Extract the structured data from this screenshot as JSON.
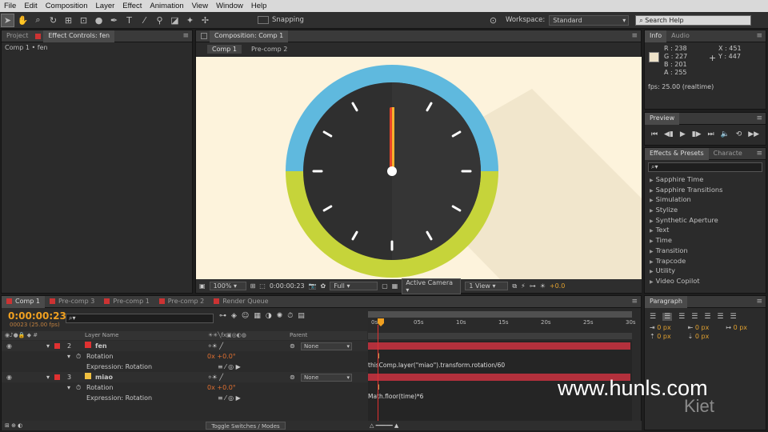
{
  "menu": [
    "File",
    "Edit",
    "Composition",
    "Layer",
    "Effect",
    "Animation",
    "View",
    "Window",
    "Help"
  ],
  "toolbar": {
    "snapping": "Snapping",
    "workspace_label": "Workspace:",
    "workspace_value": "Standard",
    "search_help": "Search Help"
  },
  "project_panel": {
    "tab_project": "Project",
    "tab_effect_controls": "Effect Controls: fen",
    "subtitle": "Comp 1 • fen"
  },
  "comp_panel": {
    "tab": "Composition: Comp 1",
    "breadcrumbs": [
      "Comp 1",
      "Pre-comp 2"
    ],
    "zoom": "100%",
    "timecode": "0:00:00:23",
    "resolution": "Full",
    "camera": "Active Camera",
    "view": "1 View",
    "exposure": "+0.0"
  },
  "info": {
    "tab_info": "Info",
    "tab_audio": "Audio",
    "r": "R : 238",
    "g": "G : 227",
    "b": "B : 201",
    "a": "A : 255",
    "x": "X : 451",
    "y": "Y : 447",
    "fps": "fps: 25.00 (realtime)"
  },
  "preview": {
    "tab": "Preview"
  },
  "effects": {
    "tab": "Effects & Presets",
    "tab2": "Characte",
    "items": [
      "Sapphire Time",
      "Sapphire Transitions",
      "Simulation",
      "Stylize",
      "Synthetic Aperture",
      "Text",
      "Time",
      "Transition",
      "Trapcode",
      "Utility",
      "Video Copilot"
    ]
  },
  "paragraph": {
    "tab": "Paragraph",
    "px_values": [
      "0 px",
      "0 px",
      "0 px",
      "0 px",
      "0 px"
    ]
  },
  "timeline": {
    "tabs": [
      "Comp 1",
      "Pre-comp 3",
      "Pre-comp 1",
      "Pre-comp 2",
      "Render Queue"
    ],
    "timecode": "0:00:00:23",
    "frames": "00023 (25.00 fps)",
    "col_layer_name": "Layer Name",
    "col_parent": "Parent",
    "ruler": [
      "0s",
      "05s",
      "10s",
      "15s",
      "20s",
      "25s",
      "30s"
    ],
    "layers": [
      {
        "num": "2",
        "name": "fen",
        "color": "#e03131",
        "parent": "None",
        "rotation_label": "Rotation",
        "rotation_value": "0x +0.0°",
        "expr_label": "Expression: Rotation",
        "expression": "thisComp.layer(\"miao\").transform.rotation/60"
      },
      {
        "num": "3",
        "name": "miao",
        "color": "#f0c040",
        "parent": "None",
        "rotation_label": "Rotation",
        "rotation_value": "0x +0.0°",
        "expr_label": "Expression: Rotation",
        "expression": "Math.floor(time)*6"
      }
    ],
    "toggle": "Toggle Switches / Modes"
  },
  "watermark": "www.hunls.com",
  "watermark2": "Kiet",
  "colors": {
    "canvas_bg": "#fdf3dc",
    "clock_top": "#5fb9de",
    "clock_bottom": "#c6d43a",
    "clock_face": "#2f2f2f",
    "hand": "#e8452a",
    "track": "#b3303c",
    "accent": "#f0a020"
  }
}
